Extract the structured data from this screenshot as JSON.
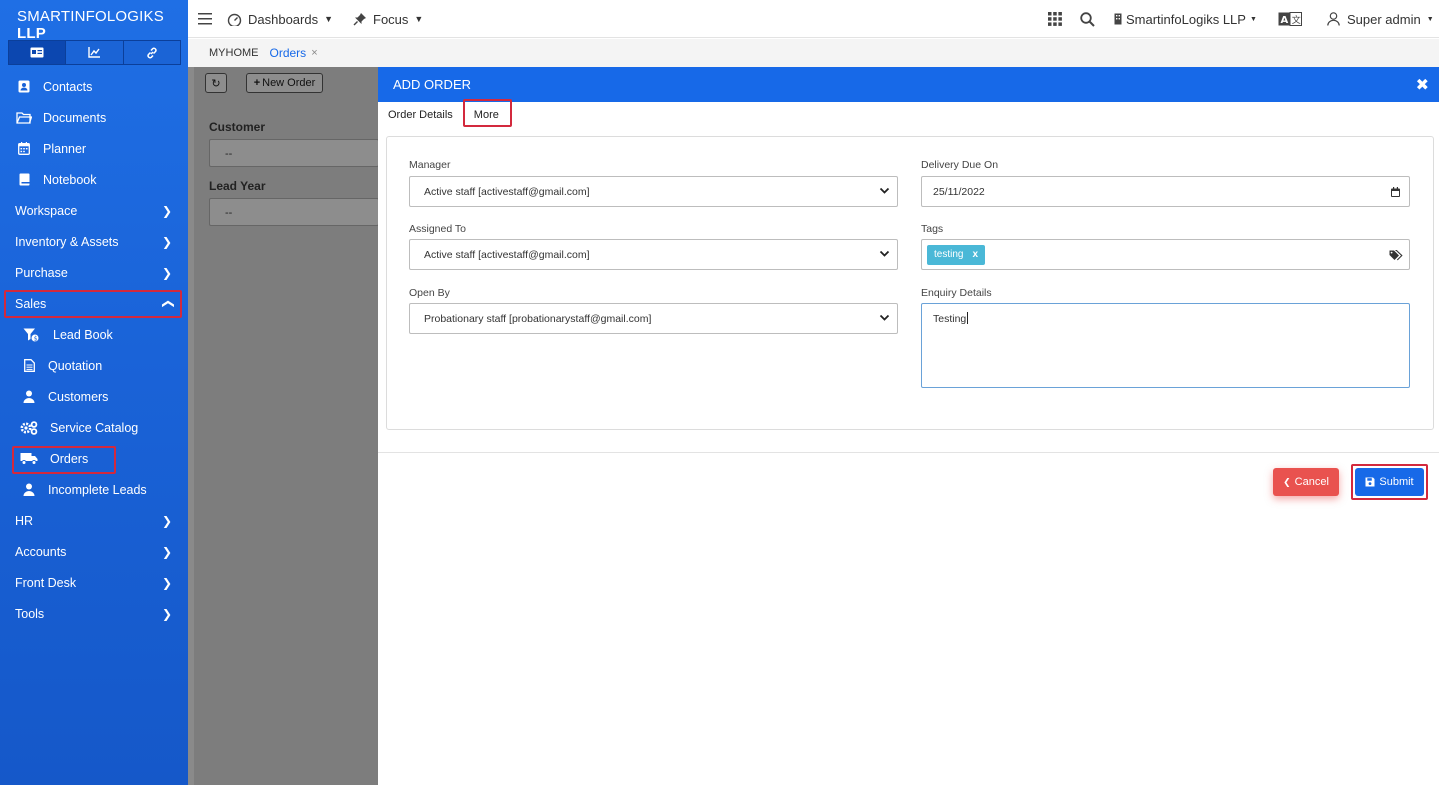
{
  "sidebar": {
    "brand_light": "SMARTINFOLOGIKS",
    "brand_bold": "LLP",
    "tab_icons": [
      "id-card-icon",
      "chart-line-icon",
      "link-icon"
    ],
    "items": [
      {
        "label": "Contacts",
        "icon": "contacts-icon"
      },
      {
        "label": "Documents",
        "icon": "folder-icon"
      },
      {
        "label": "Planner",
        "icon": "calendar-icon"
      },
      {
        "label": "Notebook",
        "icon": "notebook-icon"
      },
      {
        "label": "Workspace"
      },
      {
        "label": "Inventory & Assets"
      },
      {
        "label": "Purchase"
      },
      {
        "label": "Sales"
      },
      {
        "label": "Lead Book",
        "icon": "funnel-dollar-icon"
      },
      {
        "label": "Quotation",
        "icon": "document-icon"
      },
      {
        "label": "Customers",
        "icon": "user-icon"
      },
      {
        "label": "Service Catalog",
        "icon": "gears-icon"
      },
      {
        "label": "Orders",
        "icon": "truck-icon"
      },
      {
        "label": "Incomplete Leads",
        "icon": "user-icon"
      },
      {
        "label": "HR"
      },
      {
        "label": "Accounts"
      },
      {
        "label": "Front Desk"
      },
      {
        "label": "Tools"
      }
    ]
  },
  "topbar": {
    "dashboards": "Dashboards",
    "focus": "Focus",
    "company": "SmartinfoLogiks LLP",
    "user": "Super admin"
  },
  "breadcrumb": {
    "home": "MYHOME",
    "current": "Orders"
  },
  "background_page": {
    "new_order": "New Order",
    "customer_label": "Customer",
    "customer_value": "--",
    "lead_year_label": "Lead Year",
    "lead_year_value": "--"
  },
  "modal": {
    "title": "ADD ORDER",
    "tabs": [
      "Order Details",
      "More"
    ],
    "fields": {
      "manager_label": "Manager",
      "manager_value": "Active staff [activestaff@gmail.com]",
      "assigned_label": "Assigned To",
      "assigned_value": "Active staff [activestaff@gmail.com]",
      "openby_label": "Open By",
      "openby_value": "Probationary staff [probationarystaff@gmail.com]",
      "delivery_label": "Delivery Due On",
      "delivery_value": "25/11/2022",
      "tags_label": "Tags",
      "tags": [
        "testing"
      ],
      "enquiry_label": "Enquiry Details",
      "enquiry_value": "Testing"
    },
    "cancel_label": "Cancel",
    "submit_label": "Submit"
  },
  "colors": {
    "primary": "#1769e8",
    "cancel": "#e9524f",
    "tag": "#4ab8d7",
    "highlight": "#d3293d"
  }
}
